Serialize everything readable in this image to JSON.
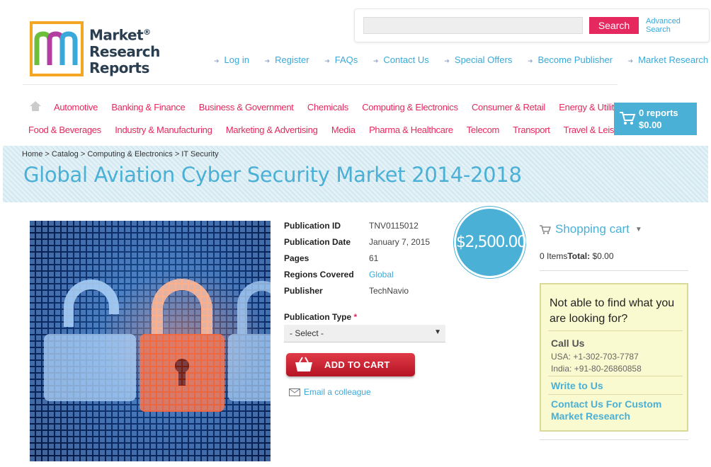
{
  "logo": {
    "line1": "Market",
    "line2": "Research",
    "line3": "Reports",
    "reg": "®",
    "mark": "m"
  },
  "search": {
    "placeholder": "",
    "button": "Search",
    "advanced_line1": "Advanced",
    "advanced_line2": "Search"
  },
  "topnav": [
    "Log in",
    "Register",
    "FAQs",
    "Contact Us",
    "Special Offers",
    "Become Publisher",
    "Market Research Blog"
  ],
  "categories_row1": [
    "Automotive",
    "Banking & Finance",
    "Business & Government",
    "Chemicals",
    "Computing & Electronics",
    "Consumer & Retail",
    "Energy & Utilities"
  ],
  "categories_row2": [
    "Food & Beverages",
    "Industry & Manufacturing",
    "Marketing & Advertising",
    "Media",
    "Pharma & Healthcare",
    "Telecom",
    "Transport",
    "Travel & Leisure"
  ],
  "cart": {
    "reports": "0 reports",
    "total": "$0.00"
  },
  "breadcrumb": "Home > Catalog > Computing & Electronics > IT Security",
  "title": "Global Aviation Cyber Security Market 2014-2018",
  "details": [
    {
      "label": "Publication ID",
      "value": "TNV0115012"
    },
    {
      "label": "Publication Date",
      "value": "January 7, 2015"
    },
    {
      "label": "Pages",
      "value": "61"
    },
    {
      "label": "Regions Covered",
      "value": "Global"
    },
    {
      "label": "Publisher",
      "value": "TechNavio"
    }
  ],
  "publication_type": {
    "label": "Publication Type",
    "required": "*",
    "selected": "- Select -"
  },
  "add_to_cart": "ADD TO CART",
  "email_colleague": "Email a colleague",
  "price": "$2,500.00",
  "shopping_cart": {
    "title": "Shopping cart",
    "items_label": "0 Items",
    "total_label": "Total:",
    "total_value": "$0.00"
  },
  "help": {
    "question": "Not able to find what you are looking for?",
    "call_title": "Call Us",
    "usa": "USA: +1-302-703-7787",
    "india": "India: +91-80-26860858",
    "write": "Write to Us",
    "custom": "Contact Us For Custom Market Research"
  },
  "colors": {
    "accent_blue": "#4ab0d5",
    "accent_pink": "#e5285d",
    "cart_red": "#c41e2e",
    "help_bg": "#fafad0"
  }
}
